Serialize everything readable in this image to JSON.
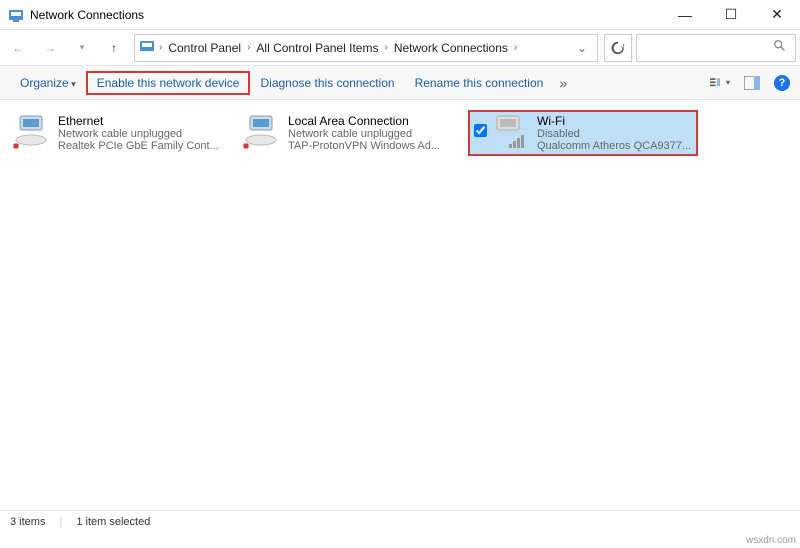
{
  "window": {
    "title": "Network Connections",
    "minimize": "—",
    "maximize": "☐",
    "close": "✕"
  },
  "breadcrumbs": {
    "items": [
      "Control Panel",
      "All Control Panel Items",
      "Network Connections"
    ]
  },
  "search": {
    "placeholder": ""
  },
  "toolbar": {
    "organize": "Organize",
    "enable": "Enable this network device",
    "diagnose": "Diagnose this connection",
    "rename": "Rename this connection",
    "overflow": "»"
  },
  "connections": [
    {
      "name": "Ethernet",
      "status": "Network cable unplugged",
      "adapter": "Realtek PCIe GbE Family Cont...",
      "disabled": false,
      "selected": false
    },
    {
      "name": "Local Area Connection",
      "status": "Network cable unplugged",
      "adapter": "TAP-ProtonVPN Windows Ad...",
      "disabled": false,
      "selected": false
    },
    {
      "name": "Wi-Fi",
      "status": "Disabled",
      "adapter": "Qualcomm Atheros QCA9377...",
      "disabled": true,
      "selected": true
    }
  ],
  "status": {
    "count": "3 items",
    "selected": "1 item selected"
  },
  "watermark": "wsxdn.com"
}
